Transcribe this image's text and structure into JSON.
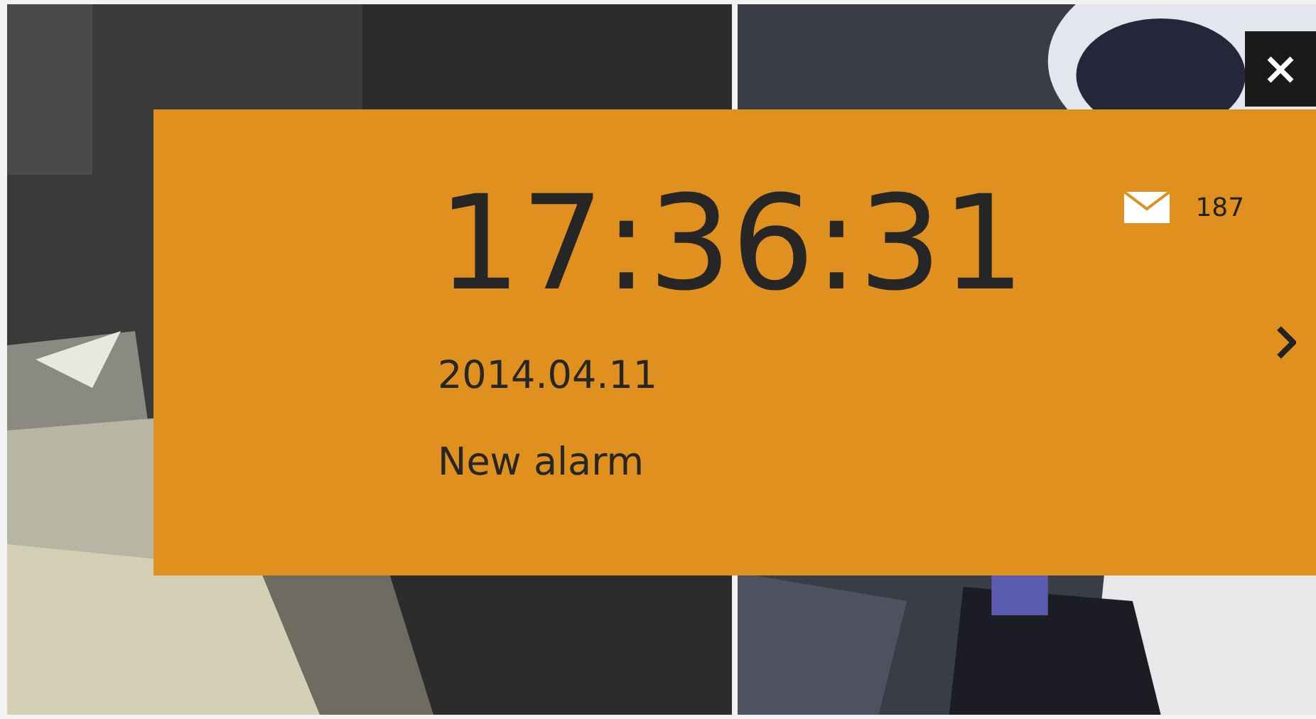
{
  "alarm": {
    "time": "17:36:31",
    "unread_count": "187",
    "date": "2014.04.11",
    "message": "New alarm"
  }
}
